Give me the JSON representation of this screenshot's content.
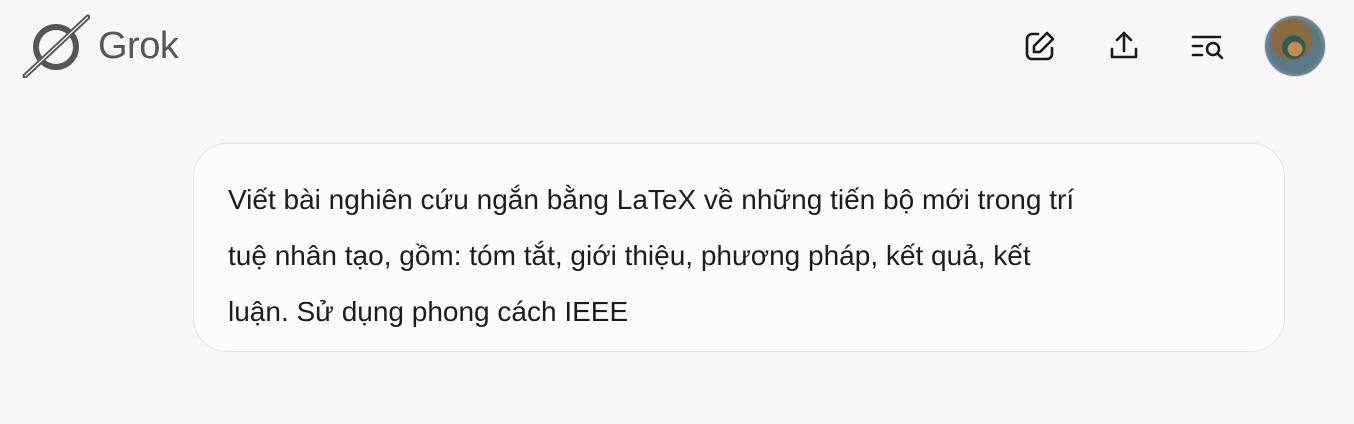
{
  "header": {
    "brand": "Grok",
    "icons": [
      "edit-icon",
      "share-icon",
      "search-history-icon"
    ],
    "avatar": "user-avatar"
  },
  "conversation": {
    "messages": [
      {
        "role": "user",
        "text": "Viết bài nghiên cứu ngắn bằng LaTeX về những tiến bộ mới trong trí\ntuệ nhân tạo, gồm: tóm tắt, giới thiệu, phương pháp, kết quả, kết\nluận. Sử dụng phong cách IEEE"
      }
    ]
  }
}
